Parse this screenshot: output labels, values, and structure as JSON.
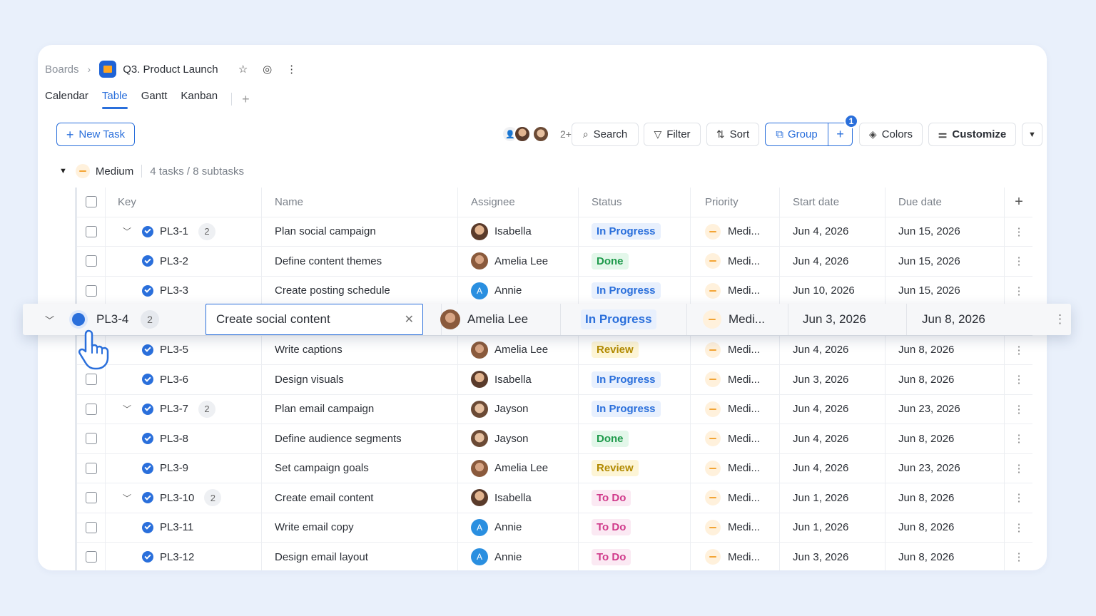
{
  "breadcrumb": {
    "root": "Boards",
    "board_title": "Q3. Product Launch"
  },
  "tabs": [
    "Calendar",
    "Table",
    "Gantt",
    "Kanban"
  ],
  "active_tab": "Table",
  "toolbar": {
    "new_task": "New Task",
    "avatars_more": "2+",
    "search": "Search",
    "filter": "Filter",
    "sort": "Sort",
    "group": "Group",
    "group_badge": "1",
    "colors": "Colors",
    "customize": "Customize"
  },
  "group": {
    "name": "Medium",
    "count": "4 tasks / 8 subtasks"
  },
  "columns": {
    "key": "Key",
    "name": "Name",
    "assignee": "Assignee",
    "status": "Status",
    "priority": "Priority",
    "start": "Start date",
    "due": "Due date"
  },
  "rows": [
    {
      "key": "PL3-1",
      "sub": "2",
      "name": "Plan social campaign",
      "assignee": "Isabella",
      "status": "In Progress",
      "priority": "Medi...",
      "start": "Jun 4, 2026",
      "due": "Jun 15, 2026"
    },
    {
      "key": "PL3-2",
      "name": "Define content themes",
      "assignee": "Amelia Lee",
      "status": "Done",
      "priority": "Medi...",
      "start": "Jun 4, 2026",
      "due": "Jun 15, 2026"
    },
    {
      "key": "PL3-3",
      "name": "Create posting schedule",
      "assignee": "Annie",
      "status": "In Progress",
      "priority": "Medi...",
      "start": "Jun 10, 2026",
      "due": "Jun 15, 2026"
    },
    {
      "key": "PL3-4",
      "sub": "2",
      "name": "Create social content",
      "assignee": "Amelia Lee",
      "status": "In Progress",
      "priority": "Medi...",
      "start": "Jun 3, 2026",
      "due": "Jun 8, 2026"
    },
    {
      "key": "PL3-5",
      "name": "Write captions",
      "assignee": "Amelia Lee",
      "status": "Review",
      "priority": "Medi...",
      "start": "Jun 4, 2026",
      "due": "Jun 8, 2026"
    },
    {
      "key": "PL3-6",
      "name": "Design visuals",
      "assignee": "Isabella",
      "status": "In Progress",
      "priority": "Medi...",
      "start": "Jun 3, 2026",
      "due": "Jun 8, 2026"
    },
    {
      "key": "PL3-7",
      "sub": "2",
      "name": "Plan email campaign",
      "assignee": "Jayson",
      "status": "In Progress",
      "priority": "Medi...",
      "start": "Jun 4, 2026",
      "due": "Jun 23, 2026"
    },
    {
      "key": "PL3-8",
      "name": "Define audience segments",
      "assignee": "Jayson",
      "status": "Done",
      "priority": "Medi...",
      "start": "Jun 4, 2026",
      "due": "Jun 8, 2026"
    },
    {
      "key": "PL3-9",
      "name": "Set campaign goals",
      "assignee": "Amelia Lee",
      "status": "Review",
      "priority": "Medi...",
      "start": "Jun 4, 2026",
      "due": "Jun 23, 2026"
    },
    {
      "key": "PL3-10",
      "sub": "2",
      "name": "Create email content",
      "assignee": "Isabella",
      "status": "To Do",
      "priority": "Medi...",
      "start": "Jun 1, 2026",
      "due": "Jun 8, 2026"
    },
    {
      "key": "PL3-11",
      "name": "Write email copy",
      "assignee": "Annie",
      "status": "To Do",
      "priority": "Medi...",
      "start": "Jun 1, 2026",
      "due": "Jun 8, 2026"
    },
    {
      "key": "PL3-12",
      "name": "Design email layout",
      "assignee": "Annie",
      "status": "To Do",
      "priority": "Medi...",
      "start": "Jun 3, 2026",
      "due": "Jun 8, 2026"
    }
  ],
  "floating_row": {
    "key": "PL3-4",
    "sub": "2",
    "name": "Create social content",
    "assignee": "Amelia Lee",
    "status": "In Progress",
    "priority": "Medi...",
    "start": "Jun 3, 2026",
    "due": "Jun 8, 2026"
  },
  "colors": {
    "accent": "#2a6fdb",
    "in_progress": "#2a6fdb",
    "done": "#1e9a4b",
    "review": "#b28a00",
    "todo": "#d03a8b",
    "priority": "#f3a536"
  }
}
